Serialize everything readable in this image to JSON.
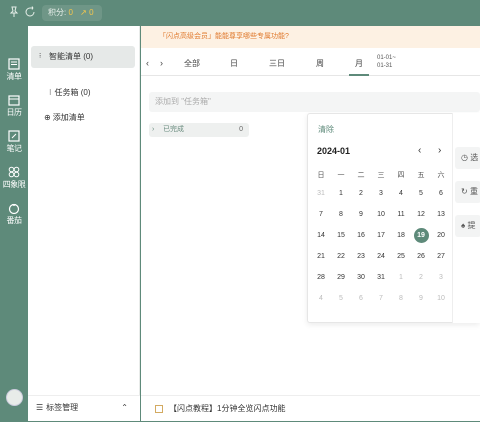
{
  "topbar": {
    "points_label": "积分:",
    "points_value": "0",
    "trend_value": "0"
  },
  "rail": {
    "items": [
      {
        "label": "清单"
      },
      {
        "label": "日历"
      },
      {
        "label": "笔记"
      },
      {
        "label": "四象限"
      },
      {
        "label": "番茄"
      }
    ]
  },
  "lists": {
    "smart_list": "智能清单 (0)",
    "inbox": "任务箱 (0)",
    "add_list": "添加清单",
    "tag_manage": "标签管理"
  },
  "main": {
    "promo": "「闪点高级会员」能能尊享哪些专属功能?",
    "tabs": [
      "全部",
      "日",
      "三日",
      "周",
      "月"
    ],
    "range_top": "01-01~",
    "range_bottom": "01-31",
    "add_placeholder": "添加到 \"任务箱\"",
    "completed_label": "已完成",
    "completed_count": "0",
    "footer_text": "【闪点教程】1分钟全览闪点功能"
  },
  "calendar": {
    "clear_label": "清除",
    "month_label": "2024-01",
    "weekdays": [
      "日",
      "一",
      "二",
      "三",
      "四",
      "五",
      "六"
    ],
    "today": "19",
    "weeks": [
      [
        "31",
        "1",
        "2",
        "3",
        "4",
        "5",
        "6"
      ],
      [
        "7",
        "8",
        "9",
        "10",
        "11",
        "12",
        "13"
      ],
      [
        "14",
        "15",
        "16",
        "17",
        "18",
        "19",
        "20"
      ],
      [
        "21",
        "22",
        "23",
        "24",
        "25",
        "26",
        "27"
      ],
      [
        "28",
        "29",
        "30",
        "31",
        "1",
        "2",
        "3"
      ],
      [
        "4",
        "5",
        "6",
        "7",
        "8",
        "9",
        "10"
      ]
    ],
    "side_buttons": [
      "选",
      "重",
      "提"
    ]
  },
  "colors": {
    "accent": "#5e8a7a",
    "points": "#f5c74b",
    "promo_bg": "#fdf1e3",
    "promo_text": "#e07a2e"
  }
}
